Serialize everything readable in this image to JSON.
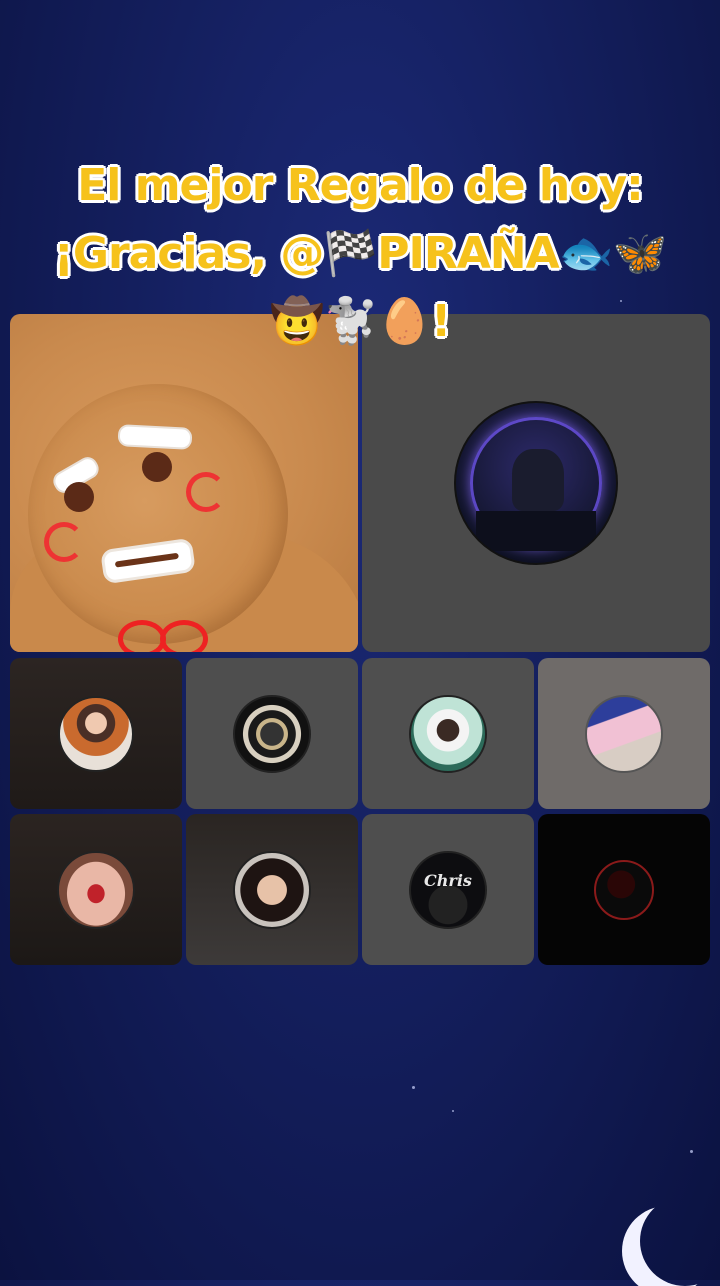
{
  "banner": {
    "line1": "El mejor Regalo de hoy:",
    "line2_prefix": "¡Gracias, @",
    "line2_flag": "🏁",
    "line2_name": "PIRAÑA",
    "line2_emojis": "🐟🦋",
    "line3_emojis": "🤠🐩🥚",
    "line3_suffix": "!"
  },
  "tiles": [
    {
      "id": "host",
      "type": "video",
      "subject": "gingerbread-man"
    },
    {
      "id": "guest-1",
      "type": "avatar",
      "avatar_icon": "hooded-hacker-avatar"
    },
    {
      "id": "guest-2",
      "type": "avatar",
      "avatar_icon": "doll-girl-avatar"
    },
    {
      "id": "guest-3",
      "type": "avatar",
      "avatar_icon": "ornate-emblem-avatar"
    },
    {
      "id": "guest-4",
      "type": "avatar",
      "avatar_icon": "woman-with-dog-avatar"
    },
    {
      "id": "guest-5",
      "type": "avatar",
      "avatar_icon": "couple-photo-avatar"
    },
    {
      "id": "guest-6",
      "type": "avatar",
      "avatar_icon": "red-lips-avatar"
    },
    {
      "id": "guest-7",
      "type": "avatar",
      "avatar_icon": "woman-portrait-avatar"
    },
    {
      "id": "guest-8",
      "type": "avatar",
      "avatar_icon": "chris-logo-avatar",
      "avatar_text": "Chris"
    },
    {
      "id": "guest-9",
      "type": "avatar",
      "avatar_icon": "dark-silhouette-avatar"
    }
  ],
  "colors": {
    "background": "#141f5e",
    "banner_text": "#f6c21b",
    "tile_gray": "#4a4a4a",
    "moon": "#f2f2ff"
  }
}
